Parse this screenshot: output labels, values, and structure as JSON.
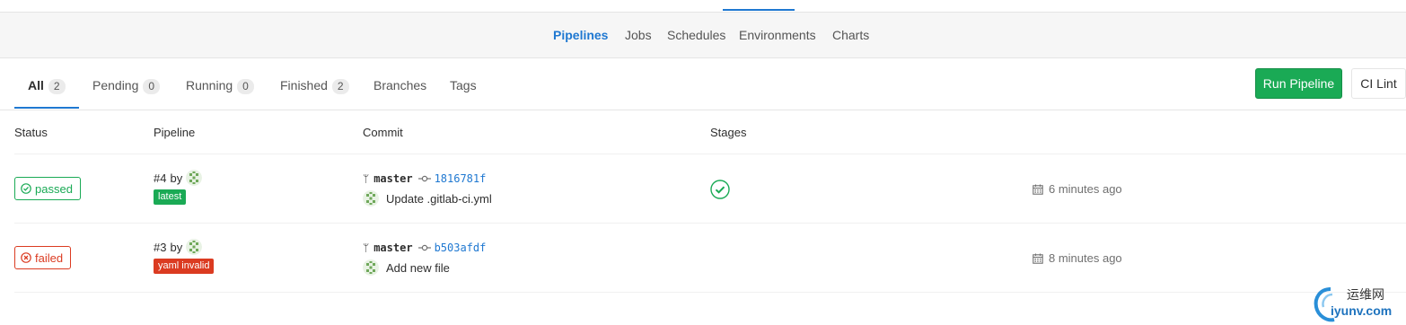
{
  "subnav": {
    "items": [
      "Pipelines",
      "Jobs",
      "Schedules",
      "Environments",
      "Charts"
    ],
    "active": "Pipelines"
  },
  "tabs": [
    {
      "label": "All",
      "count": "2"
    },
    {
      "label": "Pending",
      "count": "0"
    },
    {
      "label": "Running",
      "count": "0"
    },
    {
      "label": "Finished",
      "count": "2"
    },
    {
      "label": "Branches"
    },
    {
      "label": "Tags"
    }
  ],
  "buttons": {
    "run_pipeline": "Run Pipeline",
    "ci_lint": "CI Lint"
  },
  "table": {
    "headers": {
      "status": "Status",
      "pipeline": "Pipeline",
      "commit": "Commit",
      "stages": "Stages"
    },
    "rows": [
      {
        "status": "passed",
        "pipeline_id": "#4",
        "by": "by",
        "label": "latest",
        "branch": "master",
        "sha": "1816781f",
        "message": "Update .gitlab-ci.yml",
        "stage_status": "success",
        "time": "6 minutes ago"
      },
      {
        "status": "failed",
        "pipeline_id": "#3",
        "by": "by",
        "label": "yaml invalid",
        "branch": "master",
        "sha": "b503afdf",
        "message": "Add new file",
        "stage_status": "none",
        "time": "8 minutes ago"
      }
    ]
  },
  "colors": {
    "accent": "#1f78d1",
    "success": "#1aaa55",
    "danger": "#db3b21"
  },
  "icons": [
    "check-circle-icon",
    "x-circle-icon",
    "branch-icon",
    "commit-icon",
    "calendar-icon",
    "avatar-identicon"
  ],
  "watermark": {
    "cn": "运维网",
    "en": "iyunv.com"
  }
}
